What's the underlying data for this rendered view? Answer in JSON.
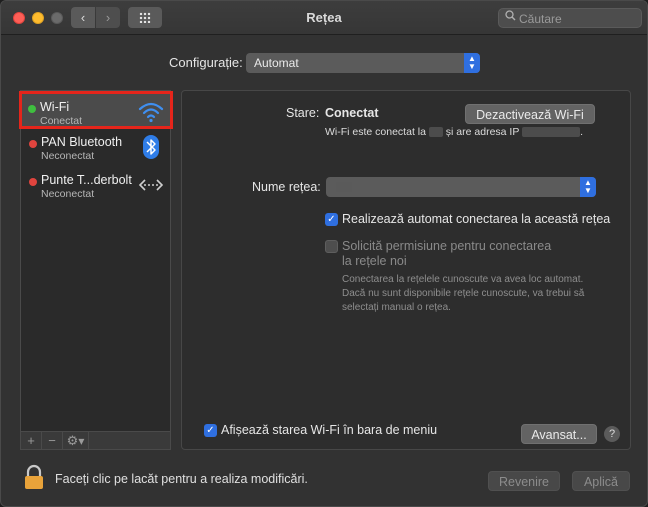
{
  "window": {
    "title": "Rețea"
  },
  "toolbar": {
    "back": "‹",
    "forward": "›"
  },
  "search": {
    "placeholder": "Căutare"
  },
  "config": {
    "label": "Configurație:",
    "value": "Automat"
  },
  "services": [
    {
      "name": "Wi-Fi",
      "status": "Conectat",
      "dot_color": "#3fbf3f",
      "icon": "wifi-icon"
    },
    {
      "name": "PAN Bluetooth",
      "status": "Neconectat",
      "dot_color": "#e0443e",
      "icon": "bluetooth-icon"
    },
    {
      "name": "Punte T...derbolt",
      "status": "Neconectat",
      "dot_color": "#e0443e",
      "icon": "thunderbolt-bridge-icon"
    }
  ],
  "sidebar_footer": {
    "add": "+",
    "remove": "−",
    "gear": "⚙"
  },
  "detail": {
    "status_label": "Stare:",
    "status_value": "Conectat",
    "disable_button": "Dezactivează Wi-Fi",
    "info_prefix": "Wi-Fi este conectat la",
    "info_middle": "și are adresa IP",
    "info_suffix": ".",
    "network_label": "Nume rețea:",
    "auto_join": "Realizează automat conectarea la această rețea",
    "ask_join_line1": "Solicită permisiune pentru conectarea",
    "ask_join_line2": "la rețele noi",
    "hint_line1": "Conectarea la rețelele cunoscute va avea loc automat.",
    "hint_line2": "Dacă nu sunt disponibile rețele cunoscute, va trebui să",
    "hint_line3": "selectați manual o rețea.",
    "show_status": "Afișează starea Wi-Fi în bara de meniu",
    "advanced_button": "Avansat...",
    "help": "?"
  },
  "footer": {
    "lock_text": "Faceți clic pe lacăt pentru a realiza modificări.",
    "revert_button": "Revenire",
    "apply_button": "Aplică"
  },
  "colors": {
    "accent": "#2f6fe0",
    "selection_outline": "#e5251b"
  }
}
